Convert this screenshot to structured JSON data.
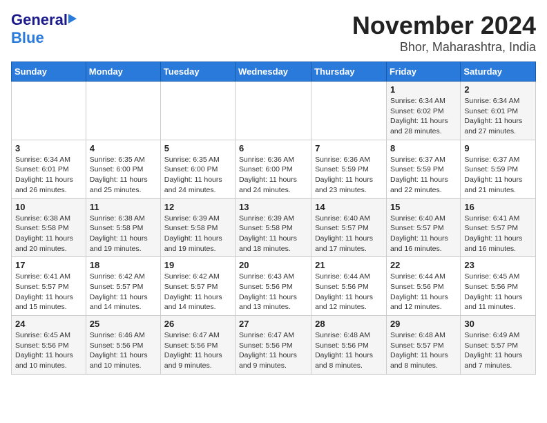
{
  "header": {
    "logo": {
      "line1": "General",
      "line2": "Blue"
    },
    "title": "November 2024",
    "subtitle": "Bhor, Maharashtra, India"
  },
  "calendar": {
    "weekdays": [
      "Sunday",
      "Monday",
      "Tuesday",
      "Wednesday",
      "Thursday",
      "Friday",
      "Saturday"
    ],
    "weeks": [
      [
        {
          "day": "",
          "info": ""
        },
        {
          "day": "",
          "info": ""
        },
        {
          "day": "",
          "info": ""
        },
        {
          "day": "",
          "info": ""
        },
        {
          "day": "",
          "info": ""
        },
        {
          "day": "1",
          "info": "Sunrise: 6:34 AM\nSunset: 6:02 PM\nDaylight: 11 hours and 28 minutes."
        },
        {
          "day": "2",
          "info": "Sunrise: 6:34 AM\nSunset: 6:01 PM\nDaylight: 11 hours and 27 minutes."
        }
      ],
      [
        {
          "day": "3",
          "info": "Sunrise: 6:34 AM\nSunset: 6:01 PM\nDaylight: 11 hours and 26 minutes."
        },
        {
          "day": "4",
          "info": "Sunrise: 6:35 AM\nSunset: 6:00 PM\nDaylight: 11 hours and 25 minutes."
        },
        {
          "day": "5",
          "info": "Sunrise: 6:35 AM\nSunset: 6:00 PM\nDaylight: 11 hours and 24 minutes."
        },
        {
          "day": "6",
          "info": "Sunrise: 6:36 AM\nSunset: 6:00 PM\nDaylight: 11 hours and 24 minutes."
        },
        {
          "day": "7",
          "info": "Sunrise: 6:36 AM\nSunset: 5:59 PM\nDaylight: 11 hours and 23 minutes."
        },
        {
          "day": "8",
          "info": "Sunrise: 6:37 AM\nSunset: 5:59 PM\nDaylight: 11 hours and 22 minutes."
        },
        {
          "day": "9",
          "info": "Sunrise: 6:37 AM\nSunset: 5:59 PM\nDaylight: 11 hours and 21 minutes."
        }
      ],
      [
        {
          "day": "10",
          "info": "Sunrise: 6:38 AM\nSunset: 5:58 PM\nDaylight: 11 hours and 20 minutes."
        },
        {
          "day": "11",
          "info": "Sunrise: 6:38 AM\nSunset: 5:58 PM\nDaylight: 11 hours and 19 minutes."
        },
        {
          "day": "12",
          "info": "Sunrise: 6:39 AM\nSunset: 5:58 PM\nDaylight: 11 hours and 19 minutes."
        },
        {
          "day": "13",
          "info": "Sunrise: 6:39 AM\nSunset: 5:58 PM\nDaylight: 11 hours and 18 minutes."
        },
        {
          "day": "14",
          "info": "Sunrise: 6:40 AM\nSunset: 5:57 PM\nDaylight: 11 hours and 17 minutes."
        },
        {
          "day": "15",
          "info": "Sunrise: 6:40 AM\nSunset: 5:57 PM\nDaylight: 11 hours and 16 minutes."
        },
        {
          "day": "16",
          "info": "Sunrise: 6:41 AM\nSunset: 5:57 PM\nDaylight: 11 hours and 16 minutes."
        }
      ],
      [
        {
          "day": "17",
          "info": "Sunrise: 6:41 AM\nSunset: 5:57 PM\nDaylight: 11 hours and 15 minutes."
        },
        {
          "day": "18",
          "info": "Sunrise: 6:42 AM\nSunset: 5:57 PM\nDaylight: 11 hours and 14 minutes."
        },
        {
          "day": "19",
          "info": "Sunrise: 6:42 AM\nSunset: 5:57 PM\nDaylight: 11 hours and 14 minutes."
        },
        {
          "day": "20",
          "info": "Sunrise: 6:43 AM\nSunset: 5:56 PM\nDaylight: 11 hours and 13 minutes."
        },
        {
          "day": "21",
          "info": "Sunrise: 6:44 AM\nSunset: 5:56 PM\nDaylight: 11 hours and 12 minutes."
        },
        {
          "day": "22",
          "info": "Sunrise: 6:44 AM\nSunset: 5:56 PM\nDaylight: 11 hours and 12 minutes."
        },
        {
          "day": "23",
          "info": "Sunrise: 6:45 AM\nSunset: 5:56 PM\nDaylight: 11 hours and 11 minutes."
        }
      ],
      [
        {
          "day": "24",
          "info": "Sunrise: 6:45 AM\nSunset: 5:56 PM\nDaylight: 11 hours and 10 minutes."
        },
        {
          "day": "25",
          "info": "Sunrise: 6:46 AM\nSunset: 5:56 PM\nDaylight: 11 hours and 10 minutes."
        },
        {
          "day": "26",
          "info": "Sunrise: 6:47 AM\nSunset: 5:56 PM\nDaylight: 11 hours and 9 minutes."
        },
        {
          "day": "27",
          "info": "Sunrise: 6:47 AM\nSunset: 5:56 PM\nDaylight: 11 hours and 9 minutes."
        },
        {
          "day": "28",
          "info": "Sunrise: 6:48 AM\nSunset: 5:56 PM\nDaylight: 11 hours and 8 minutes."
        },
        {
          "day": "29",
          "info": "Sunrise: 6:48 AM\nSunset: 5:57 PM\nDaylight: 11 hours and 8 minutes."
        },
        {
          "day": "30",
          "info": "Sunrise: 6:49 AM\nSunset: 5:57 PM\nDaylight: 11 hours and 7 minutes."
        }
      ]
    ]
  }
}
